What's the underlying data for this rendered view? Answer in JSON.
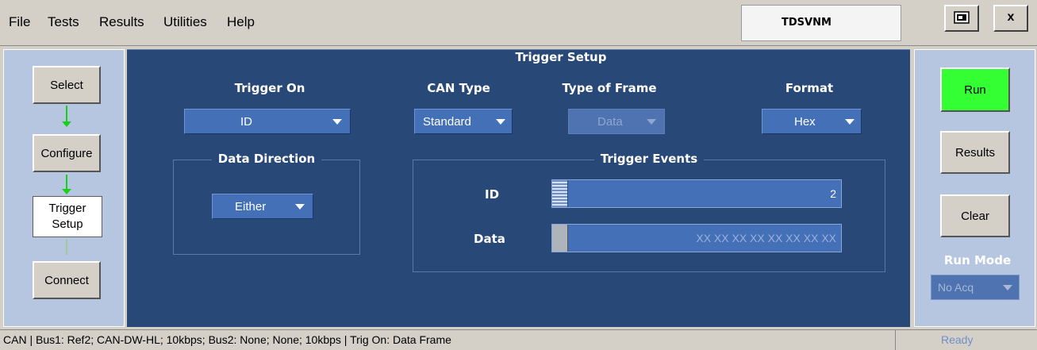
{
  "menu": {
    "file": "File",
    "tests": "Tests",
    "results": "Results",
    "utilities": "Utilities",
    "help": "Help"
  },
  "app_title": "TDSVNM",
  "window_buttons": {
    "close": "x"
  },
  "nav": {
    "select": "Select",
    "configure": "Configure",
    "trigger_setup_line1": "Trigger",
    "trigger_setup_line2": "Setup",
    "connect": "Connect"
  },
  "main": {
    "title": "Trigger Setup",
    "trigger_on": {
      "label": "Trigger On",
      "value": "ID"
    },
    "can_type": {
      "label": "CAN Type",
      "value": "Standard"
    },
    "frame_type": {
      "label": "Type of Frame",
      "value": "Data"
    },
    "format": {
      "label": "Format",
      "value": "Hex"
    },
    "data_direction": {
      "label": "Data Direction",
      "value": "Either"
    },
    "trigger_events": {
      "label": "Trigger Events",
      "id_label": "ID",
      "id_value": "2",
      "data_label": "Data",
      "data_value": "XX XX XX XX XX XX XX XX"
    }
  },
  "right": {
    "run": "Run",
    "results": "Results",
    "clear": "Clear",
    "run_mode_label": "Run Mode",
    "run_mode_value": "No Acq"
  },
  "status": {
    "text": "CAN  |  Bus1: Ref2; CAN-DW-HL; 10kbps; Bus2: None; None; 10kbps  |  Trig On: Data Frame",
    "ready": "Ready"
  },
  "colors": {
    "panel_blue": "#284878",
    "side_panel": "#b7c6e0",
    "run_green": "#33ff33",
    "arrow_green": "#18d018"
  }
}
